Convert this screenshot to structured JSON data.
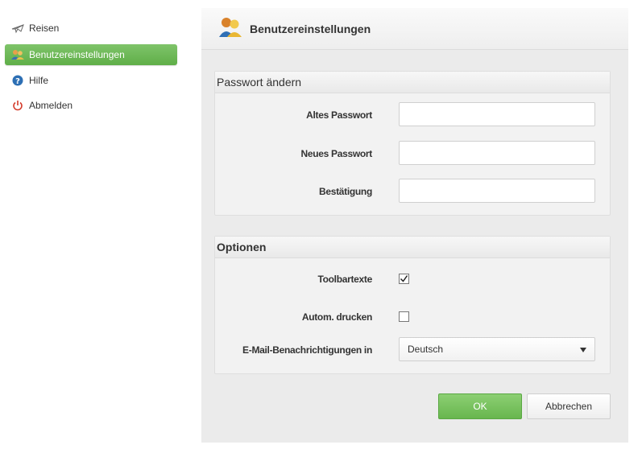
{
  "sidebar": {
    "items": [
      {
        "label": "Reisen",
        "icon": "plane-icon"
      },
      {
        "label": "Benutzereinstellungen",
        "icon": "users-icon",
        "active": true
      },
      {
        "label": "Hilfe",
        "icon": "help-icon"
      },
      {
        "label": "Abmelden",
        "icon": "power-icon"
      }
    ]
  },
  "header": {
    "title": "Benutzereinstellungen",
    "icon": "users-icon"
  },
  "password_section": {
    "title": "Passwort ändern",
    "old_password_label": "Altes Passwort",
    "old_password_value": "",
    "new_password_label": "Neues Passwort",
    "new_password_value": "",
    "confirm_label": "Bestätigung",
    "confirm_value": ""
  },
  "options_section": {
    "title": "Optionen",
    "toolbar_texts_label": "Toolbartexte",
    "toolbar_texts_checked": true,
    "auto_print_label": "Autom. drucken",
    "auto_print_checked": false,
    "email_lang_label": "E-Mail-Benachrichtigungen in",
    "email_lang_value": "Deutsch"
  },
  "buttons": {
    "ok_label": "OK",
    "cancel_label": "Abbrechen"
  },
  "colors": {
    "accent_green": "#6cb852",
    "help_blue": "#2d6fb4",
    "power_red": "#d43a2a"
  }
}
